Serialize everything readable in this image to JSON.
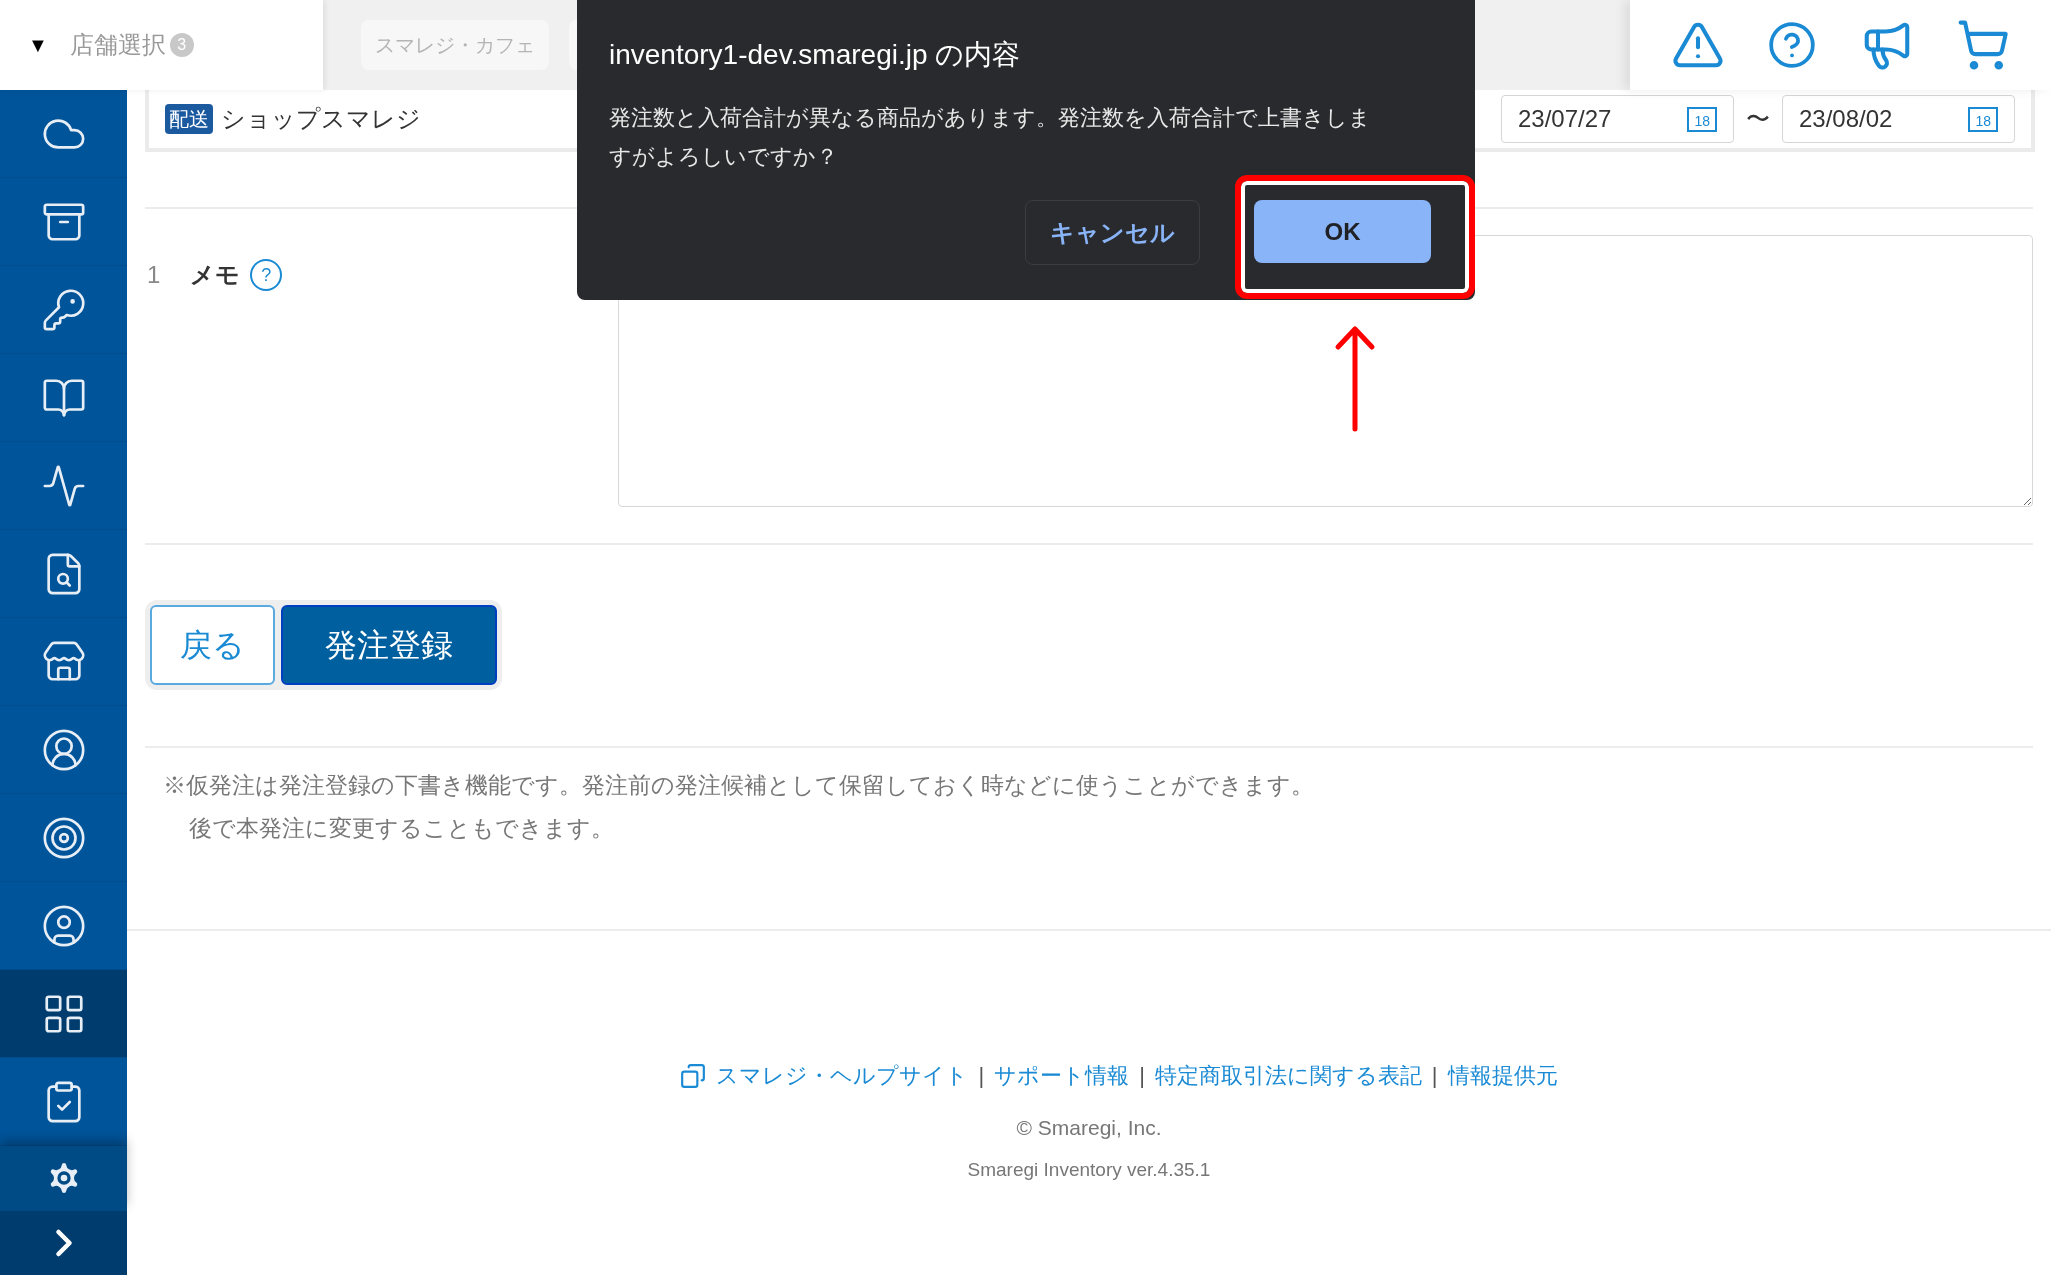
{
  "header": {
    "store_select": {
      "caret": "▼",
      "label": "店舗選択",
      "count": "3"
    },
    "store_chips": [
      "スマレジ・カフェ"
    ]
  },
  "sidebar": {
    "items": [
      {
        "selected": false
      },
      {
        "selected": false
      },
      {
        "selected": false
      },
      {
        "selected": false
      },
      {
        "selected": false
      },
      {
        "selected": false
      },
      {
        "selected": false
      },
      {
        "selected": false
      },
      {
        "selected": false
      },
      {
        "selected": false
      },
      {
        "selected": true
      },
      {
        "selected": false
      }
    ]
  },
  "order_card": {
    "badge": "配送",
    "shop": "ショップスマレジ",
    "date_from": "23/07/27",
    "date_from_day": "18",
    "date_to": "23/08/02",
    "date_to_day": "18",
    "range_sep": "〜"
  },
  "memo": {
    "number": "1",
    "label": "メモ",
    "help": "?"
  },
  "actions": [
    {
      "label": "戻る",
      "kind": "secondary"
    },
    {
      "label": "発注登録",
      "kind": "primary"
    }
  ],
  "note": [
    "※仮発注は発注登録の下書き機能です。発注前の発注候補として保留しておく時などに使うことができます。",
    "後で本発注に変更することもできます。"
  ],
  "footer": {
    "links": [
      "スマレジ・ヘルプサイト",
      "サポート情報",
      "特定商取引法に関する表記",
      "情報提供元"
    ],
    "separator": "|",
    "copyright": "© Smaregi, Inc.",
    "version": "Smaregi Inventory ver.4.35.1"
  },
  "dialog": {
    "title": "inventory1-dev.smaregi.jp の内容",
    "message": "発注数と入荷合計が異なる商品があります。発注数を入荷合計で上書きしますがよろしいですか？",
    "buttons": [
      {
        "label": "キャンセル",
        "kind": "cancel"
      },
      {
        "label": "OK",
        "kind": "ok"
      }
    ]
  },
  "annotation": {
    "highlight_ok": true
  }
}
